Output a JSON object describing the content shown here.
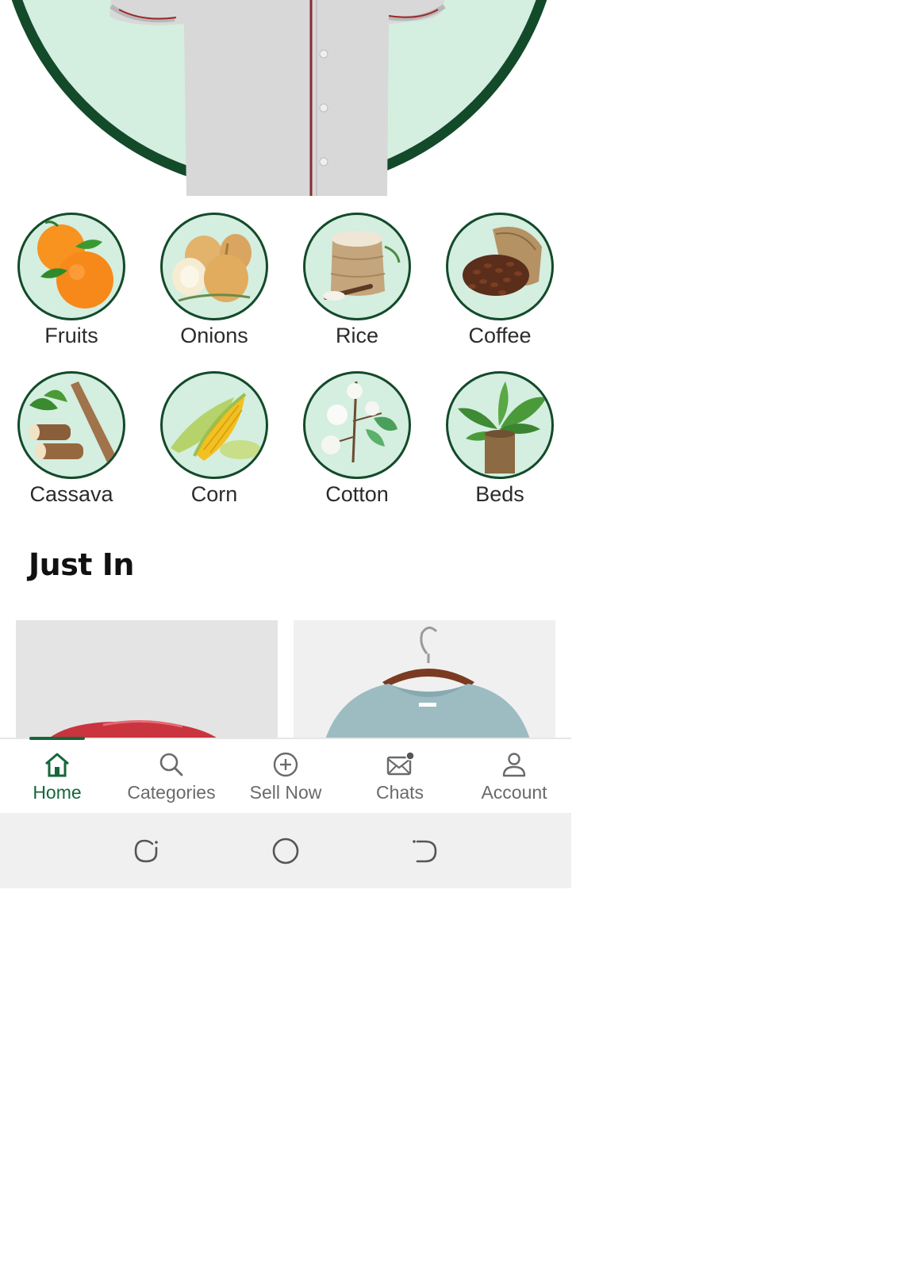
{
  "categories": [
    {
      "label": "Fruits",
      "icon": "oranges-icon"
    },
    {
      "label": "Onions",
      "icon": "onions-icon"
    },
    {
      "label": "Rice",
      "icon": "rice-sack-icon"
    },
    {
      "label": "Coffee",
      "icon": "coffee-beans-icon"
    },
    {
      "label": "Cassava",
      "icon": "cassava-icon"
    },
    {
      "label": "Corn",
      "icon": "corn-icon"
    },
    {
      "label": "Cotton",
      "icon": "cotton-icon"
    },
    {
      "label": "Beds",
      "icon": "potted-plant-icon"
    }
  ],
  "just_in": {
    "title": "Just In",
    "items": [
      {
        "icon": "meat-image"
      },
      {
        "icon": "tshirt-on-hanger-image"
      }
    ]
  },
  "bottom_nav": {
    "active": "Home",
    "items": [
      {
        "label": "Home",
        "icon": "home-icon"
      },
      {
        "label": "Categories",
        "icon": "search-icon"
      },
      {
        "label": "Sell Now",
        "icon": "plus-circle-icon"
      },
      {
        "label": "Chats",
        "icon": "mail-icon"
      },
      {
        "label": "Account",
        "icon": "person-icon"
      }
    ]
  },
  "colors": {
    "brand_dark": "#134a2a",
    "accent": "#17663a",
    "circle_fill": "#d4eee0"
  }
}
